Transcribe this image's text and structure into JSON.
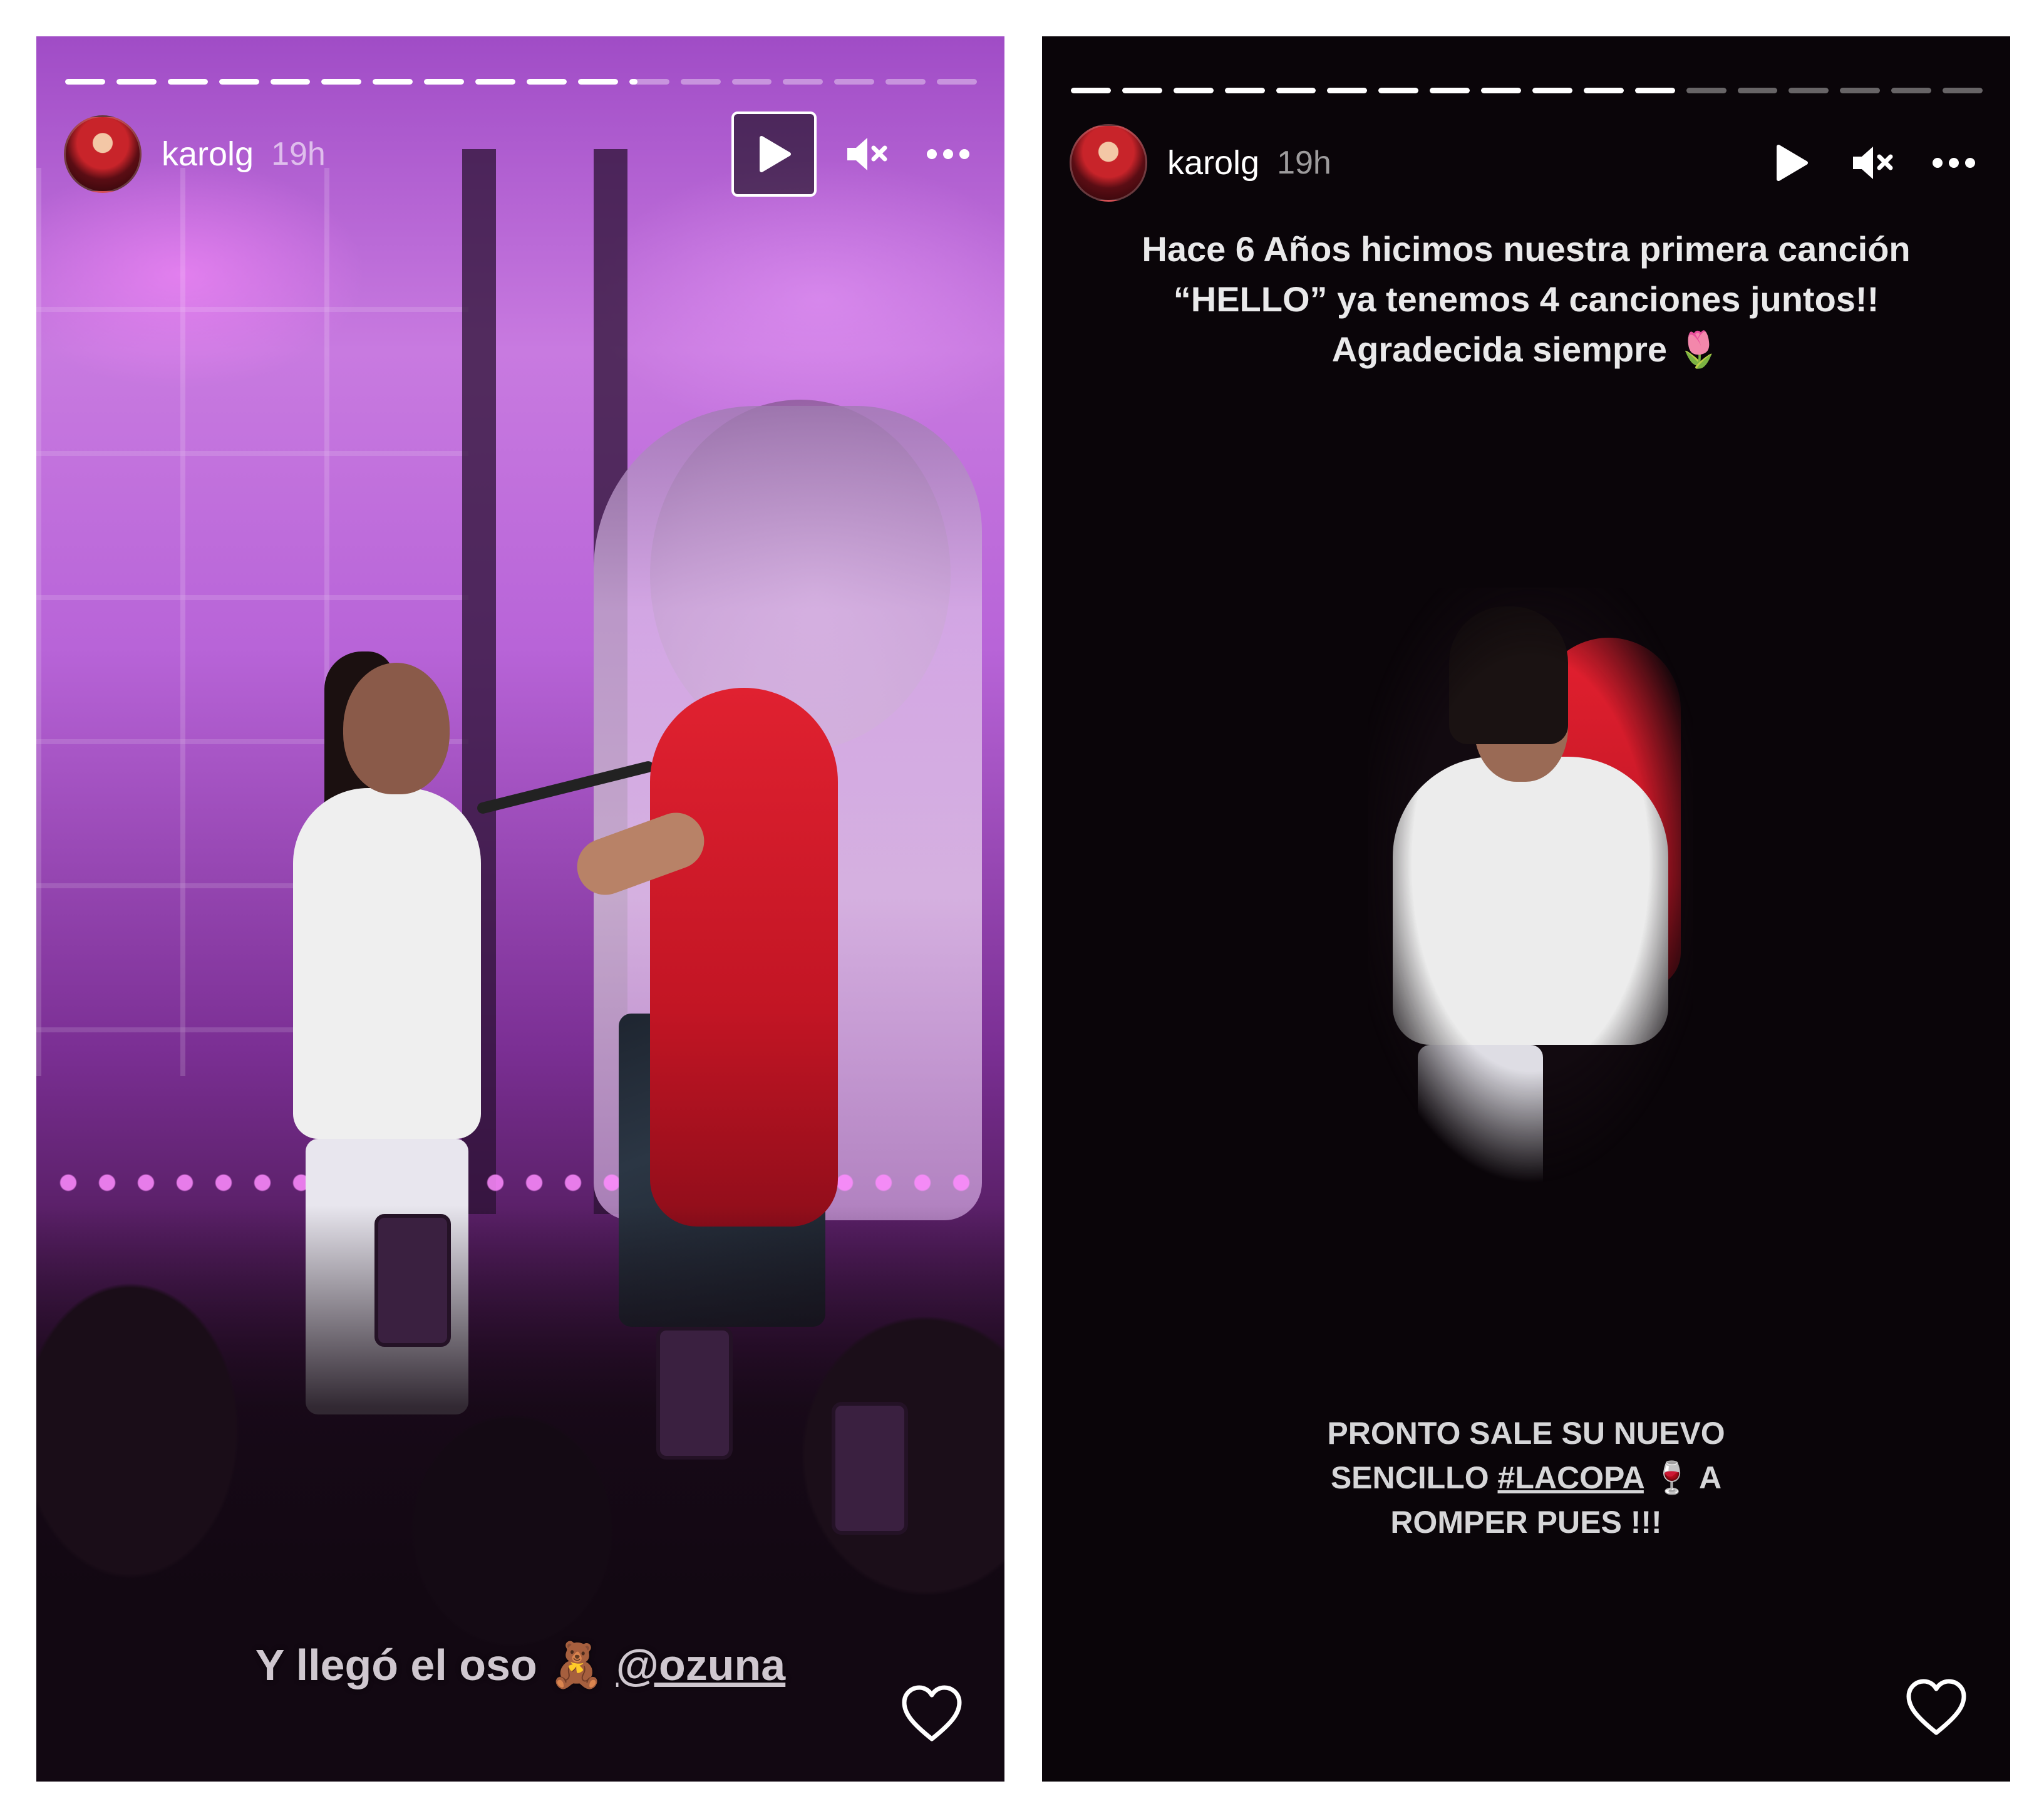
{
  "stories": [
    {
      "username": "karolg",
      "time": "19h",
      "progress_segments": 18,
      "progress_current": 11,
      "progress_current_fill": 0.2,
      "caption_text": "Y llegó el oso 🧸 ",
      "caption_mention": "@ozuna",
      "icons": {
        "play": "play-icon",
        "mute": "volume-muted-icon",
        "more": "more-options-icon",
        "like": "heart-icon"
      }
    },
    {
      "username": "karolg",
      "time": "19h",
      "progress_segments": 18,
      "progress_current": 12,
      "progress_current_fill": 0.0,
      "caption_lines": [
        "Hace 6 Años hicimos nuestra primera canción",
        "“HELLO” ya tenemos 4 canciones juntos!!",
        "Agradecida siempre 🌷"
      ],
      "bottom_lines": {
        "line1": "PRONTO SALE SU NUEVO",
        "line2_prefix": "SENCILLO ",
        "hashtag": "#LACOPA",
        "line2_suffix": " 🍷 A",
        "line3": "ROMPER PUES !!!"
      },
      "icons": {
        "play": "play-icon",
        "mute": "volume-muted-icon",
        "more": "more-options-icon",
        "like": "heart-icon"
      }
    }
  ]
}
